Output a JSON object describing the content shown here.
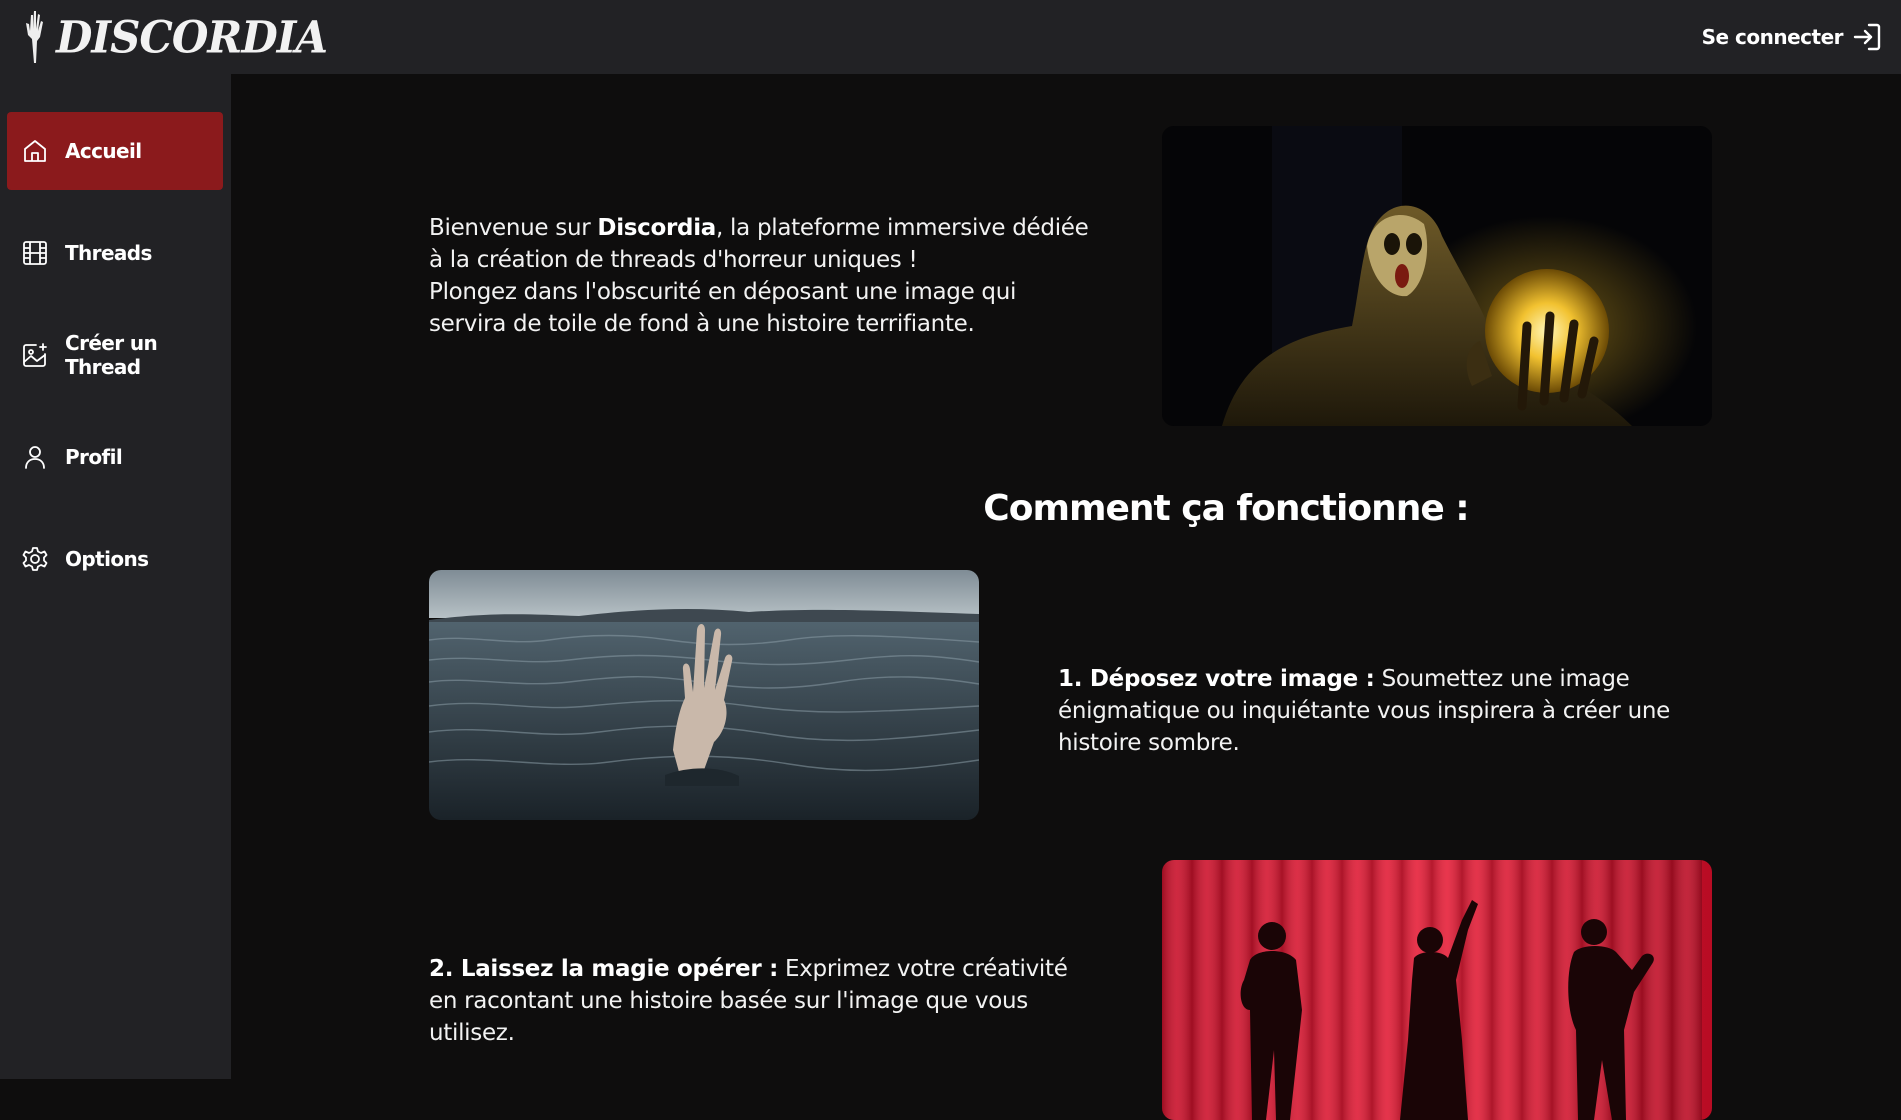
{
  "app": {
    "logo_text": "DISCORDIA"
  },
  "header": {
    "login_label": "Se connecter"
  },
  "sidebar": {
    "items": [
      {
        "label": "Accueil",
        "icon": "home-icon",
        "active": true
      },
      {
        "label": "Threads",
        "icon": "film-icon",
        "active": false
      },
      {
        "label": "Créer un Thread",
        "icon": "image-add-icon",
        "active": false
      },
      {
        "label": "Profil",
        "icon": "user-icon",
        "active": false
      },
      {
        "label": "Options",
        "icon": "gear-icon",
        "active": false
      }
    ]
  },
  "intro": {
    "prefix": "Bienvenue sur ",
    "brand": "Discordia",
    "line1_rest": ", la plateforme immersive dédiée à la création de threads d'horreur uniques !",
    "line2": "Plongez dans l'obscurité en déposant une image qui servira de toile de fond à une histoire terrifiante."
  },
  "how_it_works": {
    "title": "Comment ça fonctionne :",
    "steps": [
      {
        "title": "1. Déposez votre image :",
        "text": " Soumettez une image énigmatique ou inquiétante vous inspirera à créer une histoire sombre."
      },
      {
        "title": "2. Laissez la magie opérer :",
        "text": " Exprimez votre créativité en racontant une histoire basée sur l'image que vous utilisez."
      }
    ]
  },
  "colors": {
    "background": "#0e0d0d",
    "sidebar": "#222225",
    "accent": "#8b1a1c"
  }
}
